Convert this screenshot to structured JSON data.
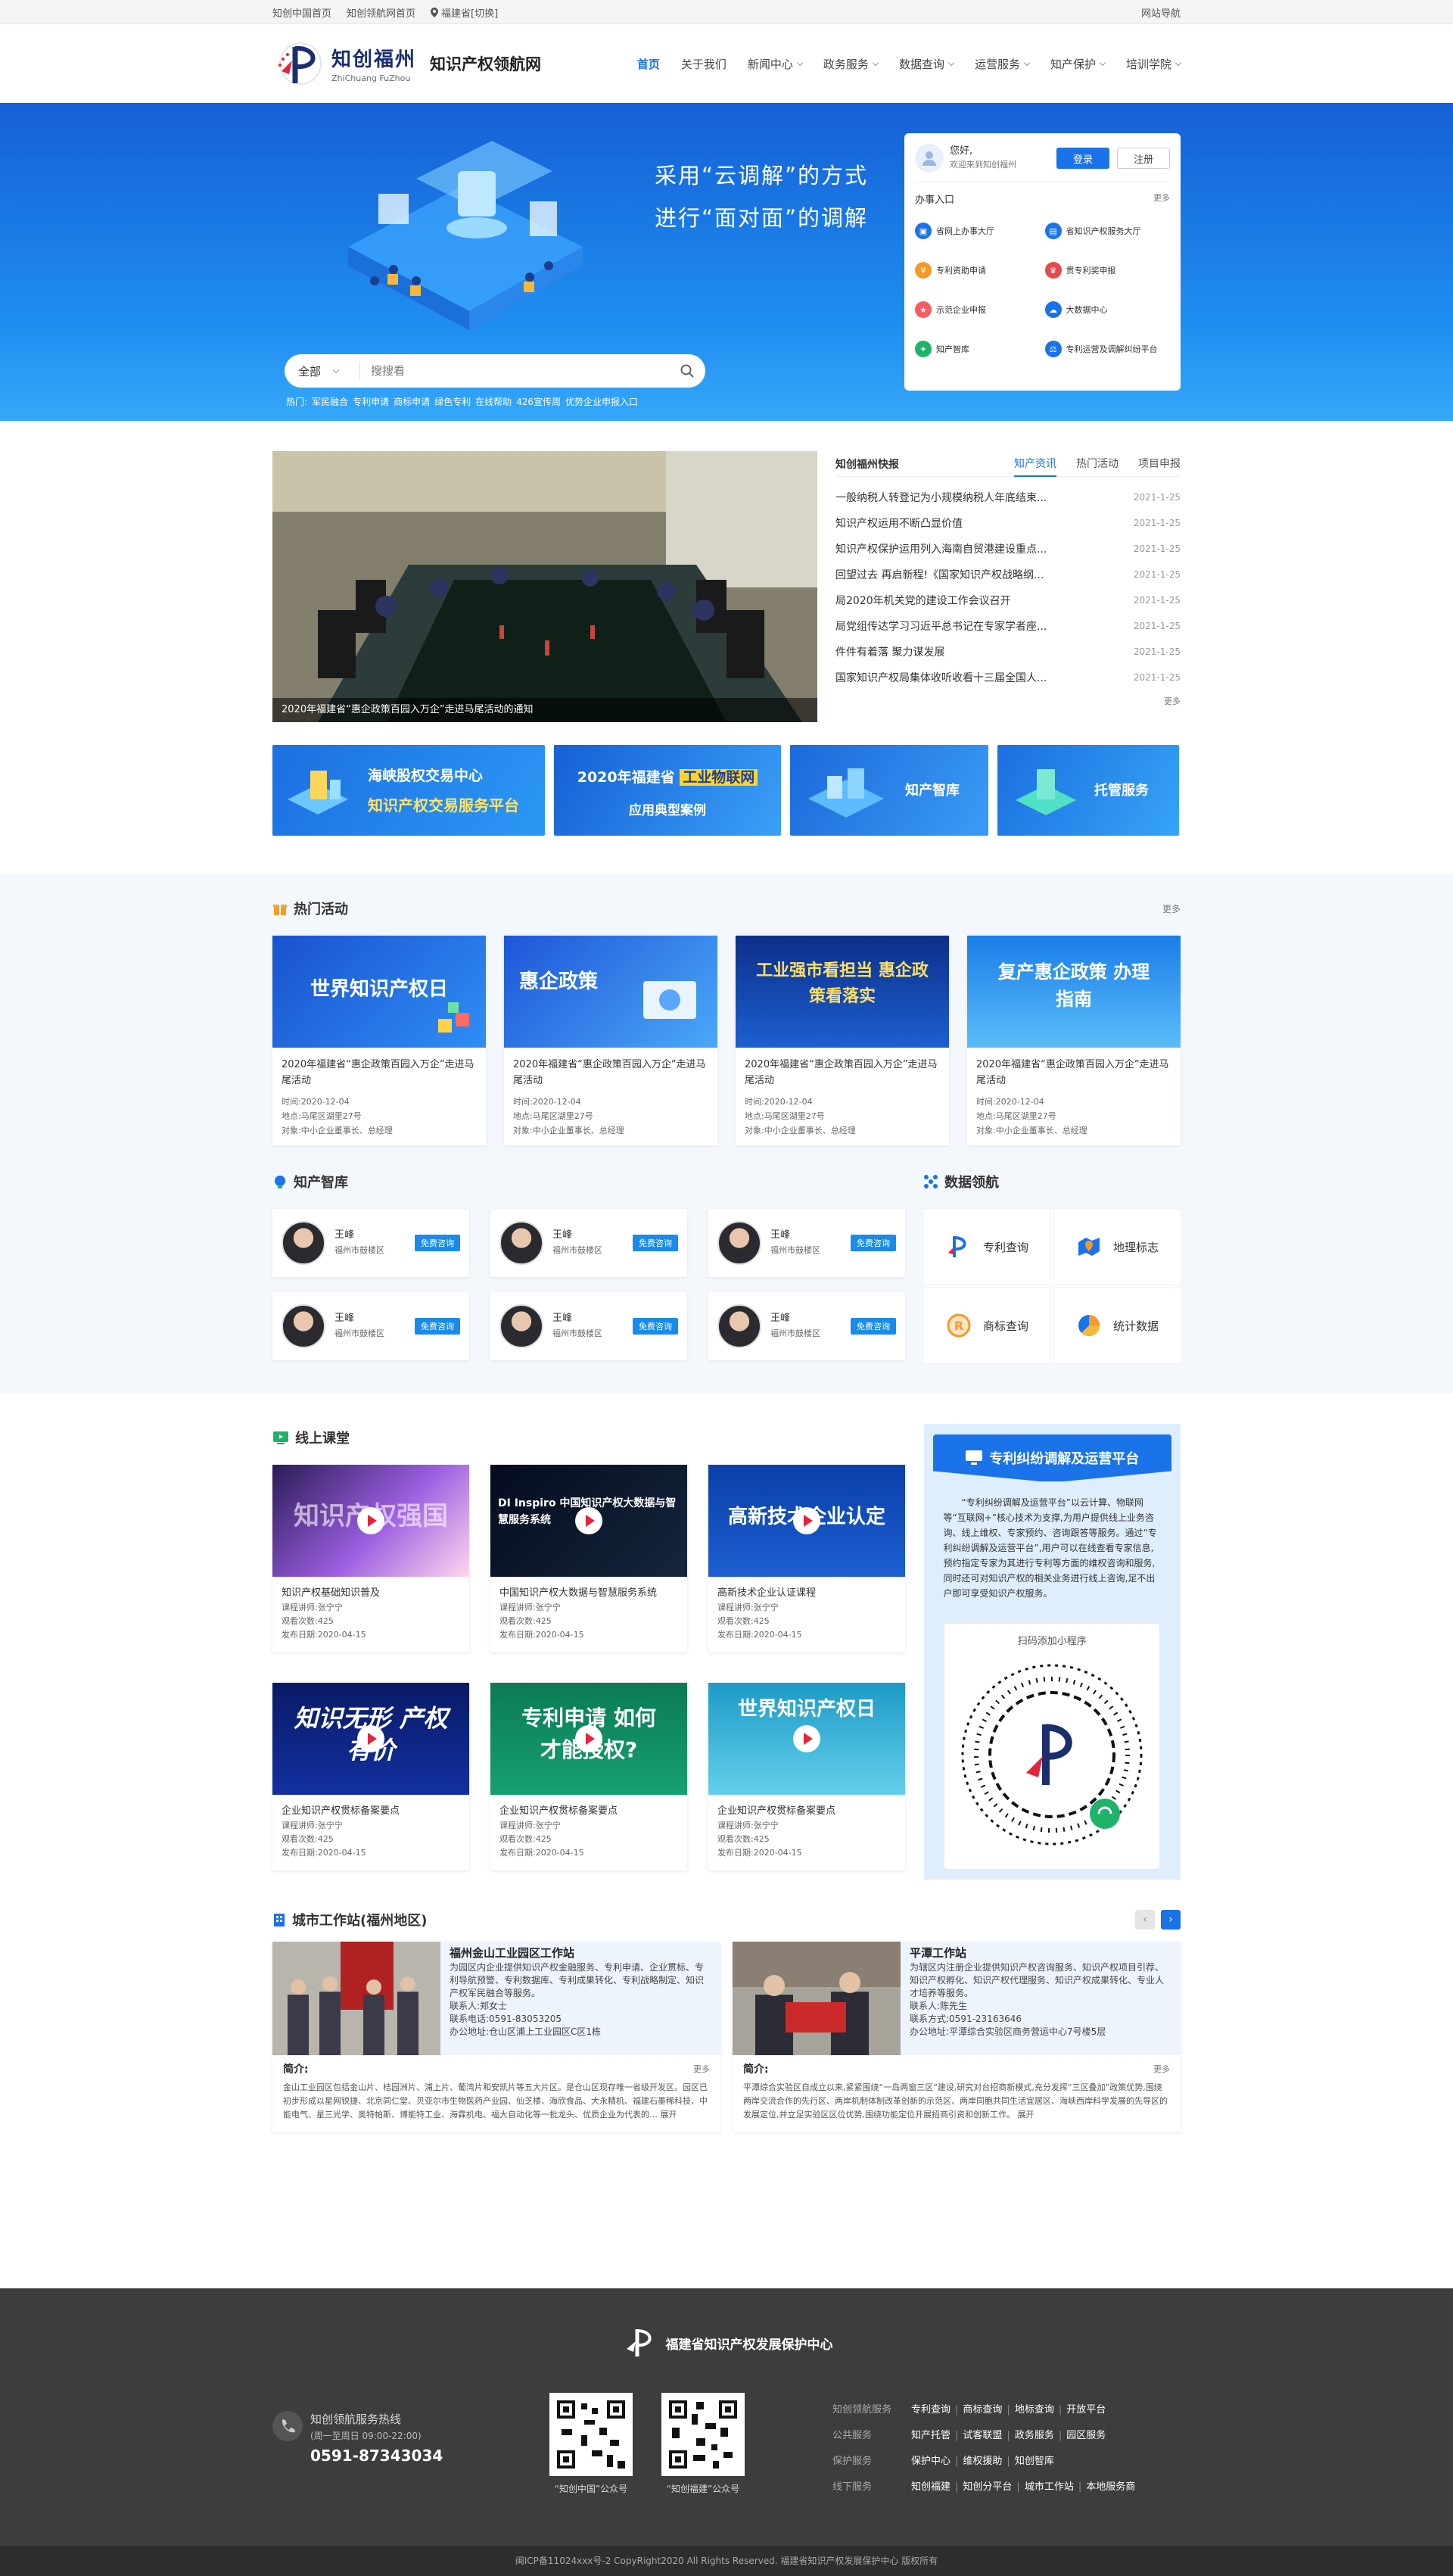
{
  "topbar": {
    "links": [
      "知创中国首页",
      "知创领航网首页"
    ],
    "location": "福建省[切换]",
    "sitemap": "网站导航"
  },
  "header": {
    "logo_cn": "知创福州",
    "logo_en": "ZhiChuang FuZhou",
    "site_name": "知识产权领航网",
    "nav": [
      {
        "label": "首页",
        "active": true,
        "dropdown": false
      },
      {
        "label": "关于我们",
        "active": false,
        "dropdown": false
      },
      {
        "label": "新闻中心",
        "active": false,
        "dropdown": true
      },
      {
        "label": "政务服务",
        "active": false,
        "dropdown": true
      },
      {
        "label": "数据查询",
        "active": false,
        "dropdown": true
      },
      {
        "label": "运营服务",
        "active": false,
        "dropdown": true
      },
      {
        "label": "知产保护",
        "active": false,
        "dropdown": true
      },
      {
        "label": "培训学院",
        "active": false,
        "dropdown": true
      }
    ]
  },
  "banner": {
    "slogan_line1": "采用“云调解”的方式",
    "slogan_line2": "进行“面对面”的调解",
    "search_scope": "全部",
    "search_placeholder": "搜搜看",
    "hot_label": "热门:",
    "hot_tags": [
      "军民融合",
      "专利申请",
      "商标申请",
      "绿色专利",
      "在线帮助",
      "426宣传周",
      "优势企业申报入口"
    ]
  },
  "user_panel": {
    "greeting": "您好,",
    "welcome": "欢迎来到知创福州",
    "login": "登录",
    "register": "注册",
    "section_title": "办事入口",
    "more": "更多",
    "services": [
      "省网上办事大厅",
      "省知识产权服务大厅",
      "专利资助申请",
      "贯专利奖申报",
      "示范企业申报",
      "大数据中心",
      "知产智库",
      "专利运营及调解纠纷平台"
    ],
    "service_colors": [
      "#1a73e8",
      "#1a73e8",
      "#f39b2a",
      "#e5484d",
      "#f25d5d",
      "#1a73e8",
      "#1fb36a",
      "#1a73e8"
    ]
  },
  "news": {
    "image_caption": "2020年福建省“惠企政策百园入万企”走进马尾活动的通知",
    "section_title": "知创福州快报",
    "tabs": [
      "知产资讯",
      "热门活动",
      "项目申报"
    ],
    "items": [
      {
        "title": "一般纳税人转登记为小规模纳税人年底结束...",
        "date": "2021-1-25"
      },
      {
        "title": "知识产权运用不断凸显价值",
        "date": "2021-1-25"
      },
      {
        "title": "知识产权保护运用列入海南自贸港建设重点...",
        "date": "2021-1-25"
      },
      {
        "title": "回望过去 再启新程!《国家知识产权战略纲...",
        "date": "2021-1-25"
      },
      {
        "title": "局2020年机关党的建设工作会议召开",
        "date": "2021-1-25"
      },
      {
        "title": "局党组传达学习习近平总书记在专家学者座...",
        "date": "2021-1-25"
      },
      {
        "title": "件件有着落 聚力谋发展",
        "date": "2021-1-25"
      },
      {
        "title": "国家知识产权局集体收听收看十三届全国人...",
        "date": "2021-1-25"
      }
    ],
    "more": "更多"
  },
  "promos": [
    {
      "line1": "海峡股权交易中心",
      "line2": "知识产权交易服务平台"
    },
    {
      "line1": "2020年福建省",
      "highlight": "工业物联网",
      "line2": "应用典型案例"
    },
    {
      "line1": "知产智库"
    },
    {
      "line1": "托管服务"
    }
  ],
  "activities": {
    "title": "热门活动",
    "more": "更多",
    "items": [
      {
        "cover": "世界知识产权日",
        "title": "2020年福建省“惠企政策百园入万企”走进马尾活动",
        "time": "时间:2020-12-04",
        "place": "地点:马尾区湖里27号",
        "target": "对象:中小企业董事长、总经理"
      },
      {
        "cover": "惠企政策",
        "title": "2020年福建省“惠企政策百园入万企”走进马尾活动",
        "time": "时间:2020-12-04",
        "place": "地点:马尾区湖里27号",
        "target": "对象:中小企业董事长、总经理"
      },
      {
        "cover": "工业强市看担当 惠企政策看落实",
        "title": "2020年福建省“惠企政策百园入万企”走进马尾活动",
        "time": "时间:2020-12-04",
        "place": "地点:马尾区湖里27号",
        "target": "对象:中小企业董事长、总经理"
      },
      {
        "cover": "复产惠企政策 办理指南",
        "title": "2020年福建省“惠企政策百园入万企”走进马尾活动",
        "time": "时间:2020-12-04",
        "place": "地点:马尾区湖里27号",
        "target": "对象:中小企业董事长、总经理"
      }
    ]
  },
  "experts": {
    "title": "知产智库",
    "items": [
      {
        "name": "王峰",
        "area": "福州市鼓楼区",
        "btn": "免费咨询"
      },
      {
        "name": "王峰",
        "area": "福州市鼓楼区",
        "btn": "免费咨询"
      },
      {
        "name": "王峰",
        "area": "福州市鼓楼区",
        "btn": "免费咨询"
      },
      {
        "name": "王峰",
        "area": "福州市鼓楼区",
        "btn": "免费咨询"
      },
      {
        "name": "王峰",
        "area": "福州市鼓楼区",
        "btn": "免费咨询"
      },
      {
        "name": "王峰",
        "area": "福州市鼓楼区",
        "btn": "免费咨询"
      }
    ]
  },
  "datanav": {
    "title": "数据领航",
    "items": [
      "专利查询",
      "地理标志",
      "商标查询",
      "统计数据"
    ],
    "colors": [
      "#1a73e8",
      "#1a73e8",
      "#f39b2a",
      "#f39b2a"
    ]
  },
  "courses": {
    "title": "线上课堂",
    "items": [
      {
        "cover": "知识产权强国",
        "title": "知识产权基础知识普及",
        "lecturer": "课程讲师:张宁宁",
        "views": "观看次数:425",
        "date": "发布日期:2020-04-15"
      },
      {
        "cover": "DI Inspiro 中国知识产权大数据与智慧服务系统",
        "title": "中国知识产权大数据与智慧服务系统",
        "lecturer": "课程讲师:张宁宁",
        "views": "观看次数:425",
        "date": "发布日期:2020-04-15"
      },
      {
        "cover": "高新技术企业认定",
        "title": "高新技术企业认证课程",
        "lecturer": "课程讲师:张宁宁",
        "views": "观看次数:425",
        "date": "发布日期:2020-04-15"
      },
      {
        "cover": "知识无形 产权有价",
        "title": "企业知识产权贯标备案要点",
        "lecturer": "课程讲师:张宁宁",
        "views": "观看次数:425",
        "date": "发布日期:2020-04-15"
      },
      {
        "cover": "专利申请 如何才能授权?",
        "title": "企业知识产权贯标备案要点",
        "lecturer": "课程讲师:张宁宁",
        "views": "观看次数:425",
        "date": "发布日期:2020-04-15"
      },
      {
        "cover": "世界知识产权日",
        "title": "企业知识产权贯标备案要点",
        "lecturer": "课程讲师:张宁宁",
        "views": "观看次数:425",
        "date": "发布日期:2020-04-15"
      }
    ]
  },
  "platform": {
    "title": "专利纠纷调解及运营平台",
    "text": "“专利纠纷调解及运营平台”以云计算、物联网等“互联网+”核心技术为支撑,为用户提供线上业务咨询、线上维权、专家预约、咨询跟答等服务。通过“专利纠纷调解及运营平台”,用户可以在线查看专家信息,预约指定专家为其进行专利等方面的维权咨询和服务,同时还可对知识产权的相关业务进行线上咨询,足不出户即可享受知识产权服务。",
    "qr_label": "扫码添加小程序"
  },
  "stations": {
    "title": "城市工作站(福州地区)",
    "items": [
      {
        "name": "福州金山工业园区工作站",
        "desc": "为园区内企业提供知识产权金融服务、专利申请、企业贯标、专利导航预警、专利数据库、专利成果转化、专利战略制定、知识产权军民融合等服务。",
        "contact": "联系人:郑女士",
        "phone": "联系电话:0591-83053205",
        "addr": "办公地址:仓山区浦上工业园区C区1栋",
        "intro_label": "简介:",
        "more": "更多",
        "intro": "金山工业园区包括金山片、桔园洲片、浦上片、葡湾片和安凯片等五大片区。是仓山区现存唯一省级开发区。园区已初步形成以星网锐捷、北京同仁堂、贝亚尔市生物医药产业园、仙芝楼、海欣食品、大永精机、福建石墨稀科技、中能电气、星三光学、奥特帕斯、博能特工业、海霖机电、福大自动化等一批龙头、优质企业为代表的… 展开"
      },
      {
        "name": "平潭工作站",
        "desc": "为辖区内注册企业提供知识产权咨询服务、知识产权项目引荐、知识产权孵化、知识产权代理服务、知识产权成果转化、专业人才培养等服务。",
        "contact": "联系人:陈先生",
        "phone": "联系方式:0591-23163646",
        "addr": "办公地址:平潭综合实验区商务营运中心7号楼5层",
        "intro_label": "简介:",
        "more": "更多",
        "intro": "平潭综合实验区自成立以来,紧紧围绕“一岛两窗三区”建设,研究对台招商新模式,充分发挥“三区叠加”政策优势,围绕两岸交流合作的先行区、两岸机制体制改革创新的示范区、两岸同胞共同生活宜居区、海峡西岸科学发展的先导区的发展定位,并立足实验区区位优势,围绕功能定位开展招商引资和创新工作。 展开"
      }
    ]
  },
  "footer": {
    "org": "福建省知识产权发展保护中心",
    "hotline_title": "知创领航服务热线",
    "hotline_hours": "(周一至周日 09:00-22:00)",
    "hotline_number": "0591-87343034",
    "qr_labels": [
      "“知创中国”公众号",
      "“知创福建”公众号"
    ],
    "link_groups": [
      {
        "head": "知创领航服务",
        "items": [
          "专利查询",
          "商标查询",
          "地标查询",
          "开放平台"
        ]
      },
      {
        "head": "公共服务",
        "items": [
          "知产托管",
          "试客联盟",
          "政务服务",
          "园区服务"
        ]
      },
      {
        "head": "保护服务",
        "items": [
          "保护中心",
          "维权援助",
          "知创智库"
        ]
      },
      {
        "head": "线下服务",
        "items": [
          "知创福建",
          "知创分平台",
          "城市工作站",
          "本地服务商"
        ]
      }
    ],
    "copyright": "闽ICP备11024xxx号-2  CopyRight2020  All Rights Reserved.  福建省知识产权发展保护中心  版权所有"
  }
}
